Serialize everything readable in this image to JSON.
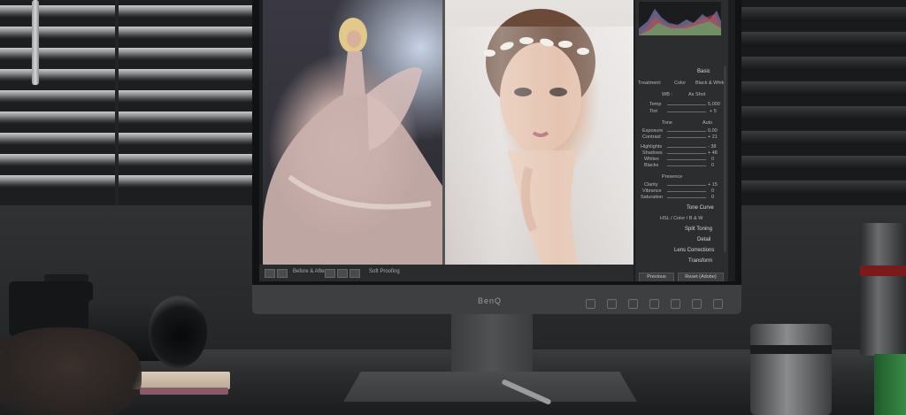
{
  "monitor": {
    "brand": "BenQ"
  },
  "lightroom": {
    "panel_title": "Basic",
    "treatment_label": "Treatment:",
    "treatment_color": "Color",
    "treatment_bw": "Black & White",
    "wb_label": "WB :",
    "wb_value": "As Shot",
    "temp_label": "Temp",
    "temp_value": "5,000",
    "tint_label": "Tint",
    "tint_value": "+ 5",
    "tone_label": "Tone",
    "tone_auto": "Auto",
    "exposure_label": "Exposure",
    "exposure_value": "0.00",
    "contrast_label": "Contrast",
    "contrast_value": "+ 21",
    "highlights_label": "Highlights",
    "highlights_value": "- 38",
    "shadows_label": "Shadows",
    "shadows_value": "+ 48",
    "whites_label": "Whites",
    "whites_value": "0",
    "blacks_label": "Blacks",
    "blacks_value": "0",
    "presence_label": "Presence",
    "clarity_label": "Clarity",
    "clarity_value": "+ 15",
    "vibrance_label": "Vibrance",
    "vibrance_value": "0",
    "saturation_label": "Saturation",
    "saturation_value": "0",
    "sections": [
      "Tone Curve",
      "Split Toning",
      "Detail",
      "Lens Corrections",
      "Transform"
    ],
    "hsl_label": "HSL / Color / B & W",
    "previous_button": "Previous",
    "reset_button": "Reset (Adobe)"
  },
  "toolbar": {
    "before_after": "Before & After :",
    "soft_proofing": "Soft Proofing"
  }
}
